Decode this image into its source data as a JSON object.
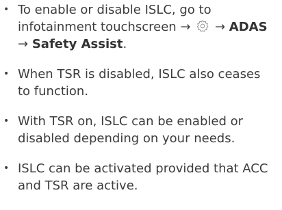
{
  "bullets": [
    {
      "part1": "To enable or disable ISLC, go to infotainment touchscreen →",
      "icon": "gear-icon",
      "part2": "→",
      "bold1": "ADAS",
      "arrow": "→",
      "bold2": "Safety Assist",
      "end": "."
    },
    {
      "text": "When TSR is disabled, ISLC also ceases to function."
    },
    {
      "text": "With TSR on, ISLC can be enabled or disabled depending on your needs."
    },
    {
      "text": "ISLC can be activated provided that ACC and TSR are active."
    }
  ]
}
